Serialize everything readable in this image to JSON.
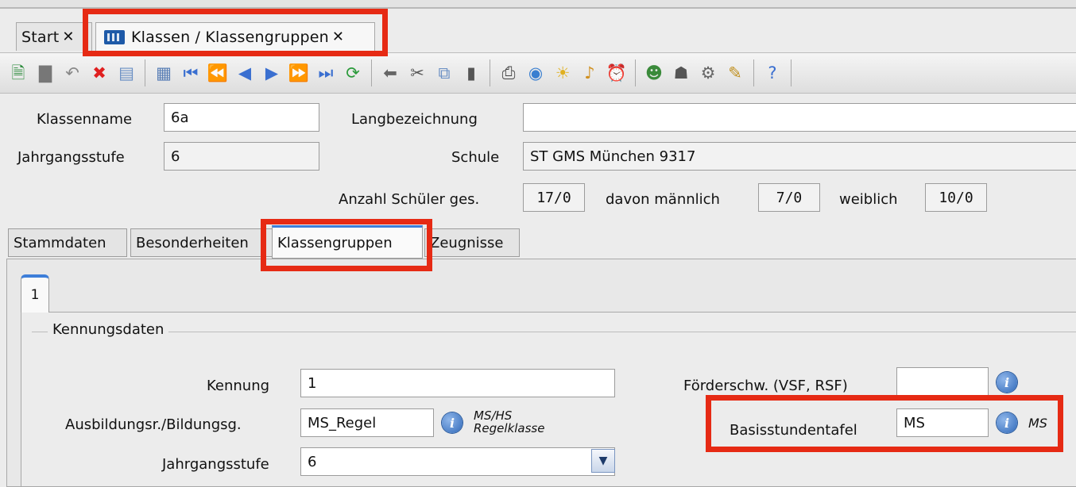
{
  "tabs": [
    {
      "label": "Start",
      "close": "✕"
    },
    {
      "label": "Klassen / Klassengruppen",
      "close": "✕"
    }
  ],
  "toolbar": {
    "icons": [
      "new-record-icon",
      "save-icon",
      "undo-icon",
      "delete-icon",
      "discard-icon",
      "list-view-icon",
      "first-record-icon",
      "fast-back-icon",
      "previous-record-icon",
      "next-record-icon",
      "fast-forward-icon",
      "last-record-icon",
      "refresh-icon",
      "back-arrow-icon",
      "cut-icon",
      "copy-icon",
      "paste-icon",
      "print-icon",
      "preview-icon",
      "hint-bulb-icon",
      "bell-icon",
      "alarm-clock-icon",
      "users-icon",
      "user-group-icon",
      "settings-icon",
      "edit-note-icon",
      "help-icon"
    ]
  },
  "form": {
    "klassenname_label": "Klassenname",
    "klassenname_value": "6a",
    "langbezeichnung_label": "Langbezeichnung",
    "langbezeichnung_value": "",
    "jahrgangsstufe_label": "Jahrgangsstufe",
    "jahrgangsstufe_value": "6",
    "schule_label": "Schule",
    "schule_value": "ST GMS München 9317",
    "anzahl_label": "Anzahl Schüler ges.",
    "anzahl_value": "17/0",
    "maennlich_label": "davon männlich",
    "maennlich_value": "7/0",
    "weiblich_label": "weiblich",
    "weiblich_value": "10/0"
  },
  "subtabs": [
    "Stammdaten",
    "Besonderheiten",
    "Klassengruppen",
    "Zeugnisse"
  ],
  "active_subtab": "Klassengruppen",
  "inner_tab": "1",
  "kennung_group": {
    "title": "Kennungsdaten",
    "kennung_label": "Kennung",
    "kennung_value": "1",
    "ausbildung_label": "Ausbildungsr./Bildungsg.",
    "ausbildung_value": "MS_Regel",
    "ausbildung_note_1": "MS/HS",
    "ausbildung_note_2": "Regelklasse",
    "jahrgangsstufe_label": "Jahrgangsstufe",
    "jahrgangsstufe_value": "6",
    "foerder_label": "Förderschw. (VSF, RSF)",
    "foerder_value": "",
    "basis_label": "Basisstundentafel",
    "basis_value": "MS",
    "basis_note": "MS"
  },
  "colors": {
    "highlight": "#e62a14",
    "active_tab_accent": "#3d7ed9",
    "info_icon": "#2f68b8"
  }
}
